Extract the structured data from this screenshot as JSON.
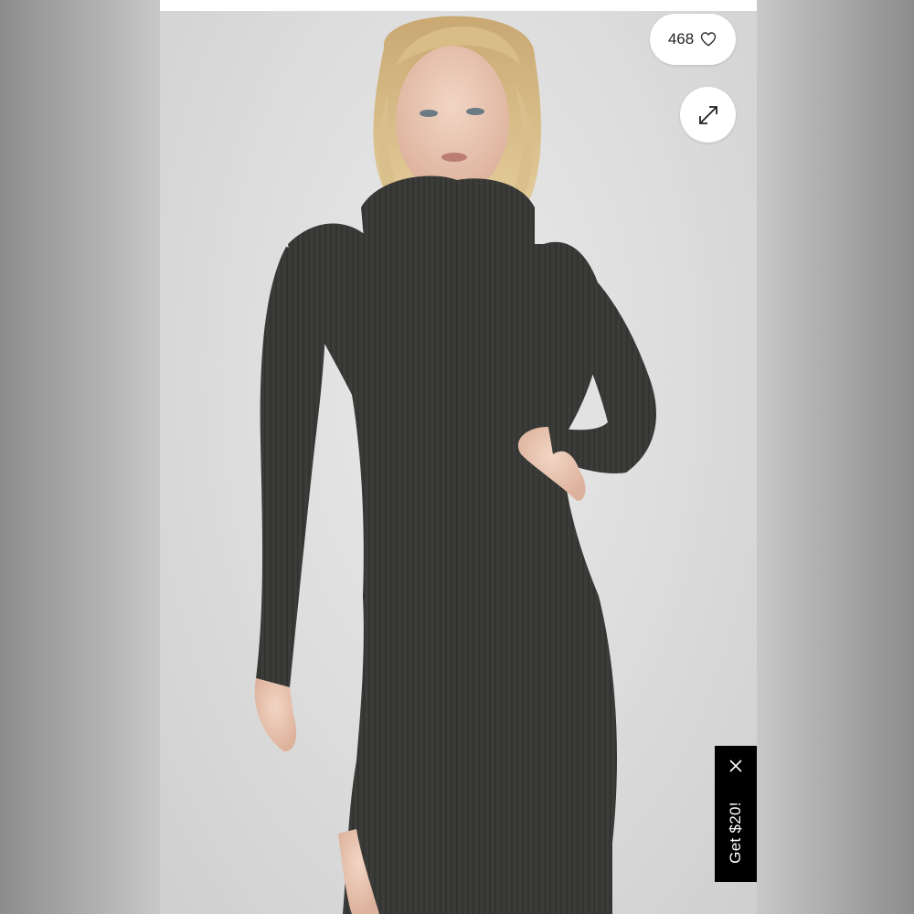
{
  "product_image": {
    "alt": "",
    "likes": {
      "count": "468",
      "icon": "heart-outline-icon"
    },
    "expand": {
      "icon": "expand-arrows-icon"
    }
  },
  "promo": {
    "label": "Get $20!",
    "close_icon": "close-x-icon",
    "background": "#000000",
    "text_color": "#ffffff"
  },
  "colors": {
    "dress": "#3b3c39",
    "backdrop": "#dcdcdc",
    "pill_background": "#ffffff"
  }
}
